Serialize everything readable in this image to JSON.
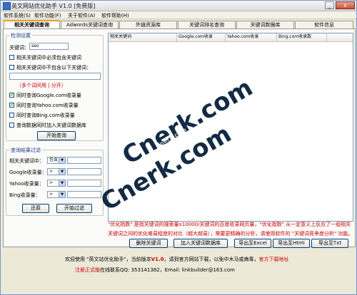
{
  "window": {
    "title": "英文网站优化助手 V1.0 [免费版]",
    "minimize_glyph": "_",
    "close_glyph": "x"
  },
  "menu": [
    "软件系统(S)",
    "软件功能(F)",
    "关于软件(A)",
    "软件帮助(H)"
  ],
  "tabs": [
    {
      "label": "相关关键词查询",
      "active": true
    },
    {
      "label": "Adwords关键词查询",
      "active": false
    },
    {
      "label": "外链资源库",
      "active": false
    },
    {
      "label": "关键词排名查询",
      "active": false
    },
    {
      "label": "关键词数据库",
      "active": false
    },
    {
      "label": "软件信息",
      "active": false
    }
  ],
  "settings": {
    "title": "检测设置",
    "keyword_label": "关键词：",
    "keyword_value": "seo",
    "must_include": "相关关键词中必须包含关键词",
    "must_exclude": "相关关键词中不包含以下关键词：",
    "multi_hint": "（多个词间用 | 分开）",
    "checks": [
      {
        "label": "同时查询Google.com收录量",
        "checked": true
      },
      {
        "label": "同时查询Yahoo.com收录量",
        "checked": true
      },
      {
        "label": "同时查询Bing.com收录量",
        "checked": false
      },
      {
        "label": "查询数据同时加入关键词数据库",
        "checked": false
      }
    ],
    "start_button": "开始查询"
  },
  "filter": {
    "title": "查询结果过滤",
    "rows": [
      {
        "label": "相关关键词中：",
        "op": "包含"
      },
      {
        "label": "Google收录量：",
        "op": ">"
      },
      {
        "label": "Yahoo收录量：",
        "op": ">"
      },
      {
        "label": "Bing收录量：",
        "op": ">"
      }
    ],
    "reset_button": "还原",
    "filter_button": "开始过滤"
  },
  "grid": {
    "columns": [
      "相关关键词",
      "Google.com收录",
      "Yahoo.com收录",
      "Bing.com收录数"
    ]
  },
  "note": "\"优化指数\" 是指关键词的搜索量x10000/关键词的百度收录网页量，\"优化指数\" 从一定意义上反应了一组相关关键词之间的优化难易程度的对比（越大越易），需要更精确的分析，请使用软件的 \"关键词竞争度分析\" 功能。",
  "actions": [
    "删除关键词",
    "加入关键词数据库",
    "导出至Excel",
    "导出至Html",
    "导出至Txt"
  ],
  "status": {
    "line1_prefix": "欢迎使用 \"英文站优化助手\"，当前版本",
    "version": "V1.0",
    "line1_suffix": "，请到官方网站下载，以免中木马或病毒，",
    "download_link": "官方下载地址",
    "line2_link": "注册正式版",
    "line2_text": "在线联系QQ: 353141382，Email: linkbuilder@163.com"
  },
  "watermark": {
    "main": "Cnerk.com",
    "sub": "Cnerk.com"
  }
}
